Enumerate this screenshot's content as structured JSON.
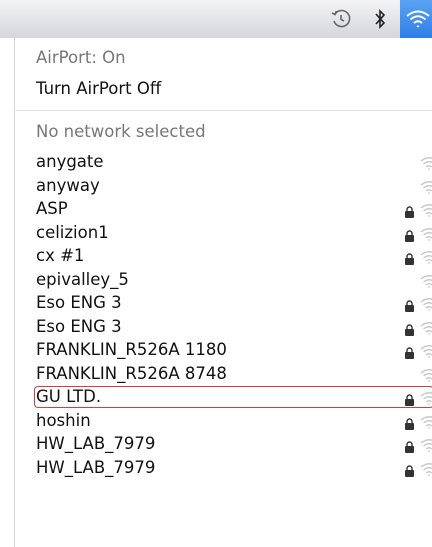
{
  "menubar": {
    "icons": [
      "time-machine-icon",
      "bluetooth-icon",
      "wifi-icon"
    ]
  },
  "airport": {
    "status": "AirPort: On",
    "toggle_label": "Turn AirPort Off"
  },
  "networks": {
    "header": "No network selected",
    "items": [
      {
        "name": "anygate",
        "secured": false
      },
      {
        "name": "anyway",
        "secured": false
      },
      {
        "name": "ASP",
        "secured": true
      },
      {
        "name": "celizion1",
        "secured": true
      },
      {
        "name": "cx #1",
        "secured": true
      },
      {
        "name": "epivalley_5",
        "secured": false
      },
      {
        "name": "Eso ENG 3",
        "secured": true
      },
      {
        "name": "Eso ENG 3",
        "secured": true
      },
      {
        "name": "FRANKLIN_R526A 1180",
        "secured": true,
        "highlighted": true
      },
      {
        "name": "FRANKLIN_R526A 8748",
        "secured": false
      },
      {
        "name": "GU LTD.",
        "secured": true
      },
      {
        "name": "hoshin",
        "secured": true
      },
      {
        "name": "HW_LAB_7979",
        "secured": true
      },
      {
        "name": "HW_LAB_7979",
        "secured": true
      }
    ]
  },
  "colors": {
    "highlight_border": "#c8443f",
    "wifi_active": "#2f7ee6"
  }
}
